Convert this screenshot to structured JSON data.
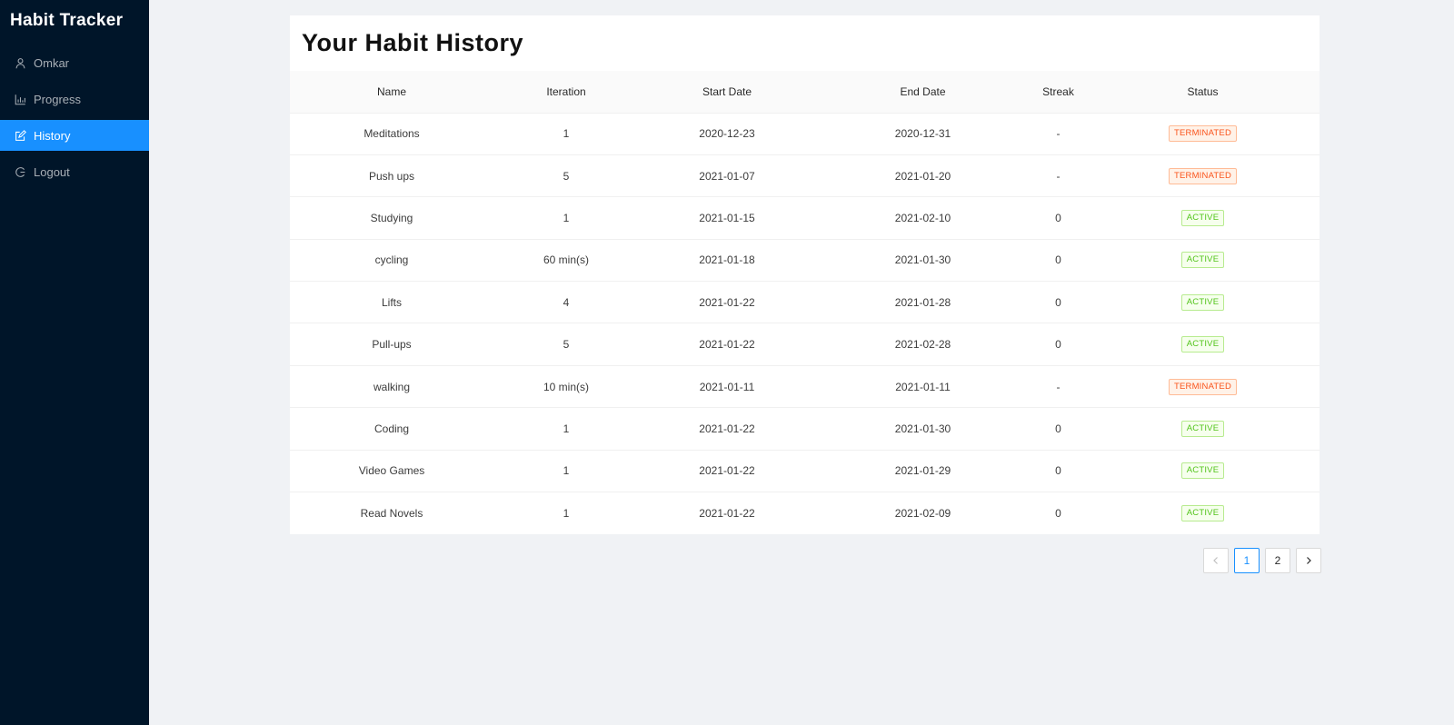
{
  "app": {
    "title": "Habit Tracker"
  },
  "sidebar": {
    "items": [
      {
        "label": "Omkar",
        "icon": "user-icon",
        "active": false
      },
      {
        "label": "Progress",
        "icon": "bar-chart-icon",
        "active": false
      },
      {
        "label": "History",
        "icon": "edit-icon",
        "active": true
      },
      {
        "label": "Logout",
        "icon": "logout-icon",
        "active": false
      }
    ]
  },
  "page": {
    "title": "Your Habit History"
  },
  "table": {
    "columns": [
      "Name",
      "Iteration",
      "Start Date",
      "End Date",
      "Streak",
      "Status"
    ],
    "rows": [
      {
        "name": "Meditations",
        "iteration": "1",
        "start": "2020-12-23",
        "end": "2020-12-31",
        "streak": "-",
        "status": "TERMINATED"
      },
      {
        "name": "Push ups",
        "iteration": "5",
        "start": "2021-01-07",
        "end": "2021-01-20",
        "streak": "-",
        "status": "TERMINATED"
      },
      {
        "name": "Studying",
        "iteration": "1",
        "start": "2021-01-15",
        "end": "2021-02-10",
        "streak": "0",
        "status": "ACTIVE"
      },
      {
        "name": "cycling",
        "iteration": "60 min(s)",
        "start": "2021-01-18",
        "end": "2021-01-30",
        "streak": "0",
        "status": "ACTIVE"
      },
      {
        "name": "Lifts",
        "iteration": "4",
        "start": "2021-01-22",
        "end": "2021-01-28",
        "streak": "0",
        "status": "ACTIVE"
      },
      {
        "name": "Pull-ups",
        "iteration": "5",
        "start": "2021-01-22",
        "end": "2021-02-28",
        "streak": "0",
        "status": "ACTIVE"
      },
      {
        "name": "walking",
        "iteration": "10 min(s)",
        "start": "2021-01-11",
        "end": "2021-01-11",
        "streak": "-",
        "status": "TERMINATED"
      },
      {
        "name": "Coding",
        "iteration": "1",
        "start": "2021-01-22",
        "end": "2021-01-30",
        "streak": "0",
        "status": "ACTIVE"
      },
      {
        "name": "Video Games",
        "iteration": "1",
        "start": "2021-01-22",
        "end": "2021-01-29",
        "streak": "0",
        "status": "ACTIVE"
      },
      {
        "name": "Read Novels",
        "iteration": "1",
        "start": "2021-01-22",
        "end": "2021-02-09",
        "streak": "0",
        "status": "ACTIVE"
      }
    ]
  },
  "pagination": {
    "pages": [
      "1",
      "2"
    ],
    "current": "1"
  },
  "colors": {
    "sidebar_bg": "#001529",
    "accent": "#1890ff",
    "terminated": "#fa541c",
    "active": "#52c41a"
  }
}
